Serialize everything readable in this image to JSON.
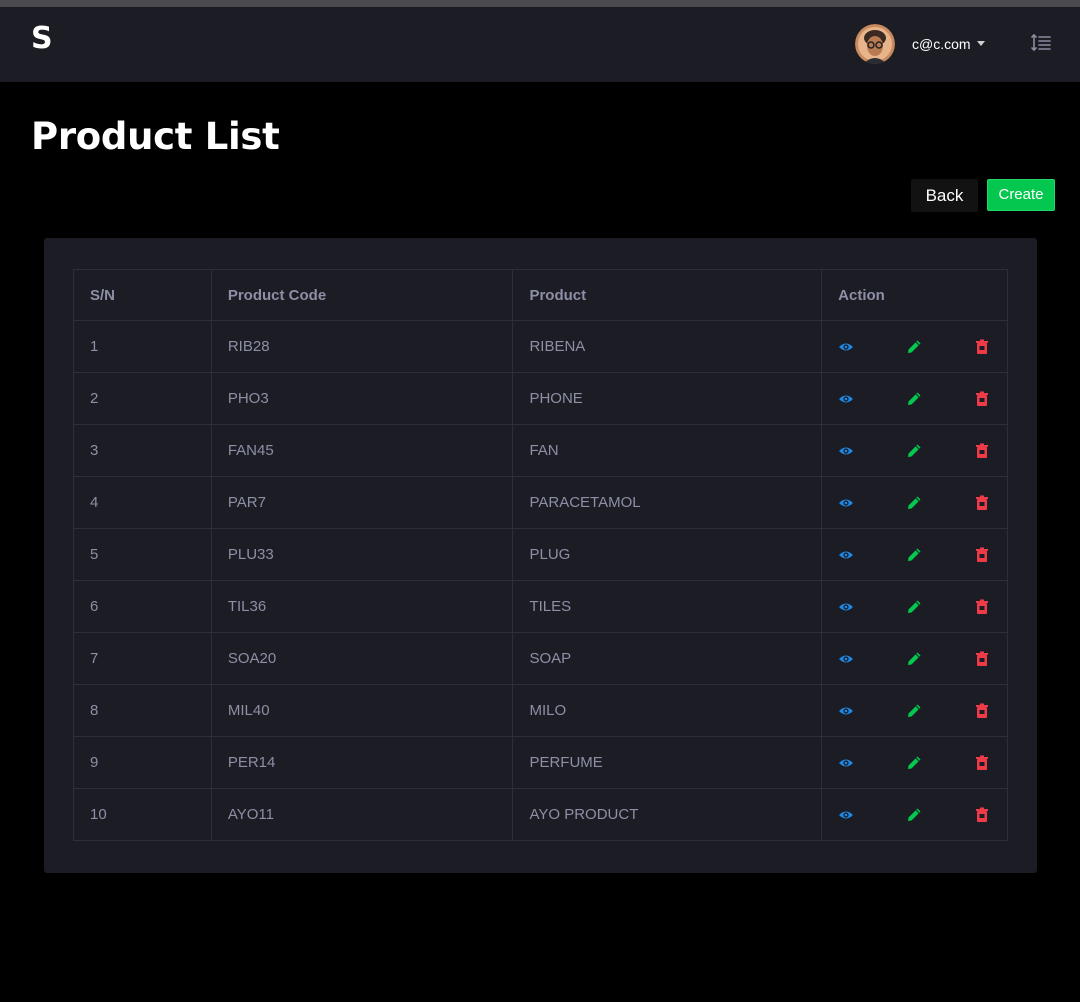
{
  "app": {
    "brand": "S"
  },
  "user": {
    "email": "c@c.com"
  },
  "page": {
    "title": "Product List"
  },
  "buttons": {
    "back": "Back",
    "create": "Create"
  },
  "table": {
    "headers": [
      "S/N",
      "Product Code",
      "Product",
      "Action"
    ],
    "rows": [
      {
        "sn": "1",
        "code": "RIB28",
        "product": "RIBENA"
      },
      {
        "sn": "2",
        "code": "PHO3",
        "product": "PHONE"
      },
      {
        "sn": "3",
        "code": "FAN45",
        "product": "FAN"
      },
      {
        "sn": "4",
        "code": "PAR7",
        "product": "PARACETAMOL"
      },
      {
        "sn": "5",
        "code": "PLU33",
        "product": "PLUG"
      },
      {
        "sn": "6",
        "code": "TIL36",
        "product": "TILES"
      },
      {
        "sn": "7",
        "code": "SOA20",
        "product": "SOAP"
      },
      {
        "sn": "8",
        "code": "MIL40",
        "product": "MILO"
      },
      {
        "sn": "9",
        "code": "PER14",
        "product": "PERFUME"
      },
      {
        "sn": "10",
        "code": "AYO11",
        "product": "AYO PRODUCT"
      }
    ]
  },
  "icons": {
    "view": "eye-icon",
    "edit": "pencil-icon",
    "delete": "trash-icon",
    "toggle": "menu-toggle-icon"
  },
  "colors": {
    "view": "#1e88e5",
    "edit": "#04c74f",
    "delete": "#ef3a4a",
    "create": "#04c74f"
  }
}
